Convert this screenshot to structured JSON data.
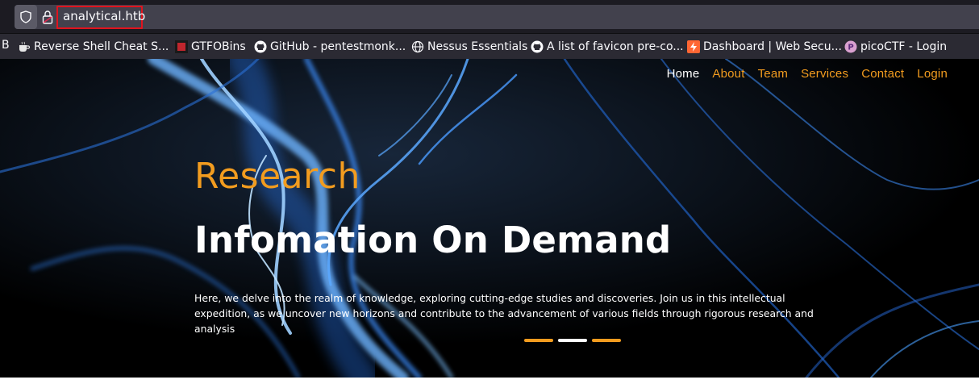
{
  "browser": {
    "url": "analytical.htb",
    "bookmarks_stub": "B",
    "bookmarks": [
      {
        "label": "Reverse Shell Cheat S...",
        "icon": "coffee-cup-icon"
      },
      {
        "label": "GTFOBins",
        "icon": "gtfobins-icon"
      },
      {
        "label": "GitHub - pentestmonk...",
        "icon": "github-icon"
      },
      {
        "label": "Nessus Essentials",
        "icon": "globe-icon"
      },
      {
        "label": "A list of favicon pre-co...",
        "icon": "github-icon"
      },
      {
        "label": "Dashboard | Web Secu...",
        "icon": "portswigger-icon"
      },
      {
        "label": "picoCTF - Login",
        "icon": "picoctf-icon"
      }
    ]
  },
  "nav": {
    "items": [
      "Home",
      "About",
      "Team",
      "Services",
      "Contact",
      "Login"
    ],
    "active_index": 0
  },
  "hero": {
    "kicker": "Research",
    "title": "Infomation On Demand",
    "description": "Here, we delve into the realm of knowledge, exploring cutting-edge studies and discoveries. Join us in this intellectual expedition, as we uncover new horizons and contribute to the advancement of various fields through rigorous research and analysis",
    "slides_total": 3,
    "active_slide": 2
  },
  "colors": {
    "accent": "#f29c1f",
    "url_highlight": "#e0141e",
    "hero_bg": "#000000"
  }
}
